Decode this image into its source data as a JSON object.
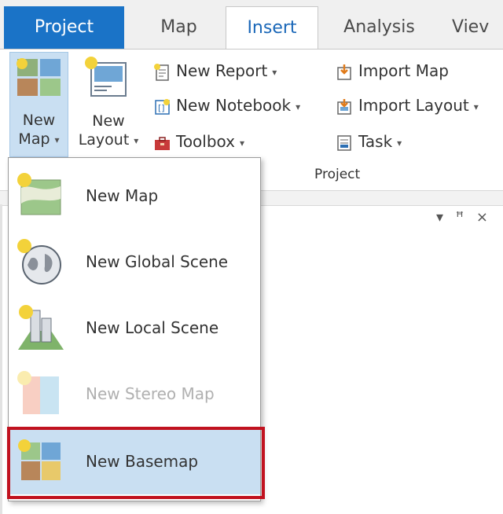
{
  "tabs": [
    {
      "label": "Project",
      "active": false
    },
    {
      "label": "Map",
      "active": false
    },
    {
      "label": "Insert",
      "active": true
    },
    {
      "label": "Analysis",
      "active": false
    },
    {
      "label": "Viev",
      "active": false
    }
  ],
  "ribbon": {
    "new_map": {
      "line1": "New",
      "line2": "Map",
      "icon": "new-map-icon"
    },
    "new_layout": {
      "line1": "New",
      "line2": "Layout",
      "icon": "new-layout-icon"
    },
    "new_report": {
      "label": "New Report",
      "icon": "report-icon"
    },
    "new_notebook": {
      "label": "New Notebook",
      "icon": "notebook-icon"
    },
    "toolbox": {
      "label": "Toolbox",
      "icon": "toolbox-icon"
    },
    "import_map": {
      "label": "Import Map",
      "icon": "import-map-icon"
    },
    "import_layout": {
      "label": "Import Layout",
      "icon": "import-layout-icon"
    },
    "task": {
      "label": "Task",
      "icon": "task-icon"
    },
    "group_label": "Project",
    "dropdown_arrow": "▾"
  },
  "pane": {
    "menu_glyph": "▾",
    "pin_glyph": "ꟸ",
    "close_glyph": "×"
  },
  "dropdown": {
    "items": [
      {
        "label": "New Map",
        "icon": "new-map-icon",
        "enabled": true
      },
      {
        "label": "New Global Scene",
        "icon": "globe-icon",
        "enabled": true
      },
      {
        "label": "New Local Scene",
        "icon": "local-scene-icon",
        "enabled": true
      },
      {
        "label": "New Stereo Map",
        "icon": "stereo-map-icon",
        "enabled": false
      },
      {
        "label": "New Basemap",
        "icon": "basemap-icon",
        "enabled": true,
        "highlighted": true
      }
    ]
  },
  "colors": {
    "accent": "#1a73c7",
    "highlight": "#c9dff2",
    "frame": "#c1121f"
  }
}
